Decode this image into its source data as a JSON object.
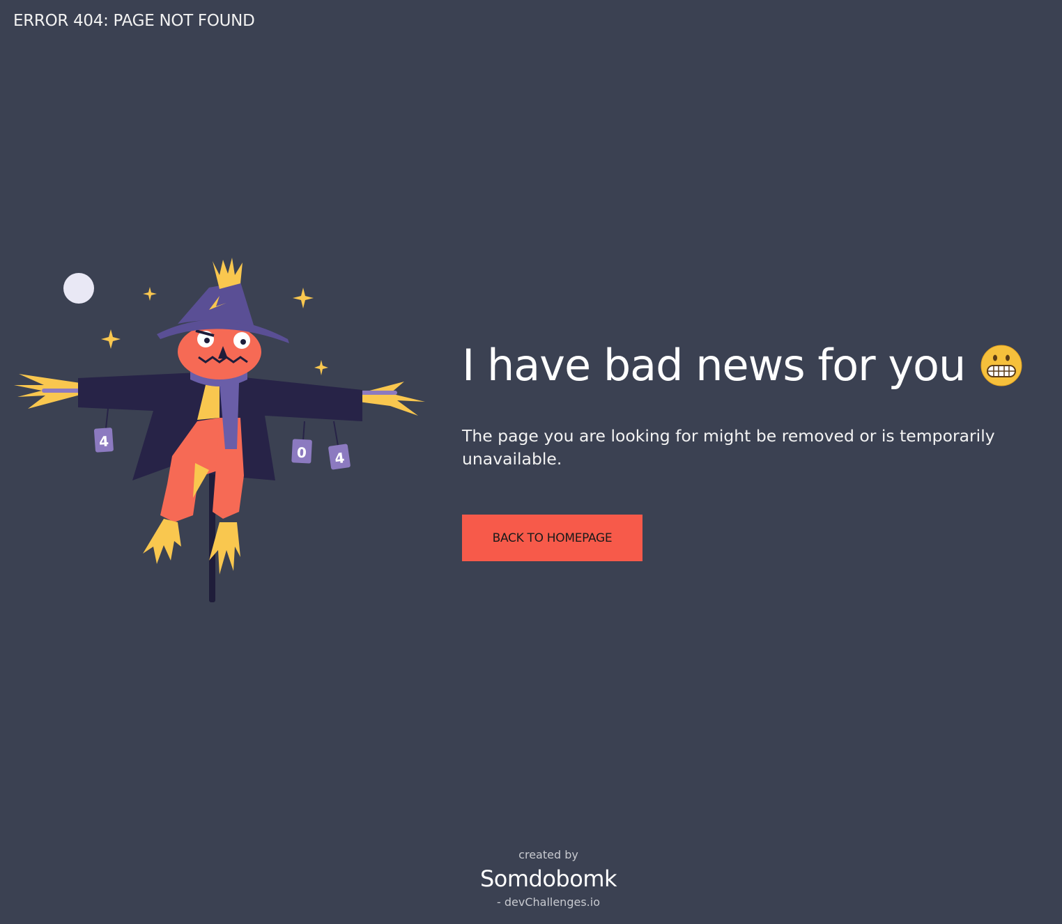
{
  "header": {
    "brand": "ERROR 404: PAGE NOT FOUND"
  },
  "main": {
    "headline": "I have bad news for you",
    "headline_emoji": "grimacing-face-icon",
    "message": "The page you are looking for might be removed or is temporarily unavailable.",
    "cta_label": "BACK TO HOMEPAGE"
  },
  "illustration": {
    "tag_left": "4",
    "tag_middle": "0",
    "tag_right": "4"
  },
  "footer": {
    "created_by": "created by",
    "author": "Somdobomk",
    "site": "- devChallenges.io"
  },
  "colors": {
    "background": "#3b4152",
    "button": "#f75a4a",
    "text": "#ffffff"
  }
}
